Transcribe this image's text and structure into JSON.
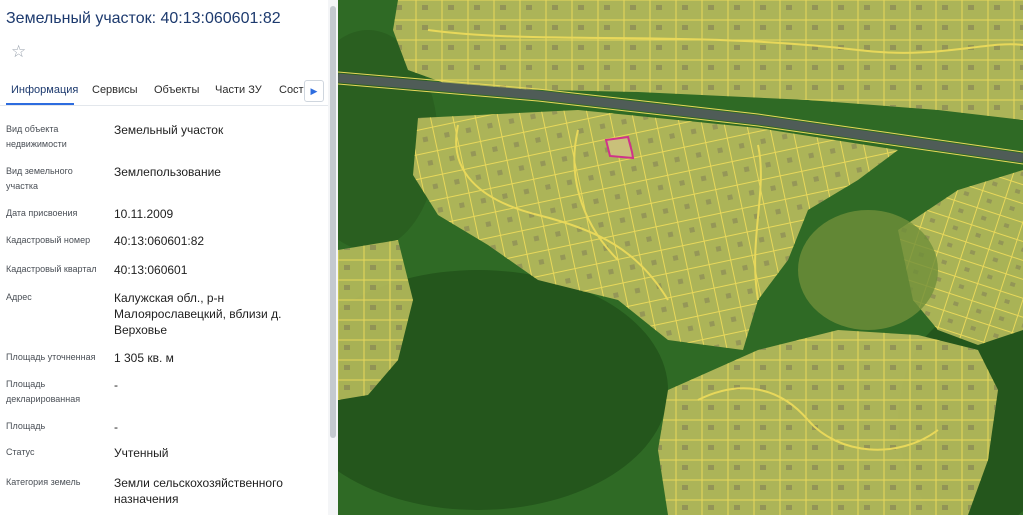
{
  "panel": {
    "title": "Земельный участок: 40:13:060601:82",
    "tabs": [
      {
        "label": "Информация"
      },
      {
        "label": "Сервисы"
      },
      {
        "label": "Объекты"
      },
      {
        "label": "Части ЗУ"
      },
      {
        "label": "Соста"
      }
    ],
    "fields": [
      {
        "label": [
          "Вид объекта",
          "недвижимости"
        ],
        "value": [
          "Земельный участок"
        ]
      },
      {
        "label": [
          "Вид земельного",
          "участка"
        ],
        "value": [
          "Землепользование"
        ]
      },
      {
        "label": [
          "Дата присвоения"
        ],
        "value": [
          "10.11.2009"
        ]
      },
      {
        "label": [
          "Кадастровый номер"
        ],
        "value": [
          "40:13:060601:82"
        ]
      },
      {
        "label": [
          "Кадастровый квартал"
        ],
        "value": [
          "40:13:060601"
        ]
      },
      {
        "label": [
          "Адрес"
        ],
        "value": [
          "Калужская обл., р-н",
          "Малоярославецкий, вблизи д.",
          "Верховье"
        ]
      },
      {
        "label": [
          "Площадь уточненная"
        ],
        "value": [
          "1 305 кв. м"
        ]
      },
      {
        "label": [
          "Площадь",
          "декларированная"
        ],
        "value": [
          "-"
        ]
      },
      {
        "label": [
          "Площадь"
        ],
        "value": [
          "-"
        ]
      },
      {
        "label": [
          "Статус"
        ],
        "value": [
          "Учтенный"
        ]
      },
      {
        "label": [
          "Категория земель"
        ],
        "value": [
          "Земли сельскохозяйственного",
          "назначения"
        ]
      }
    ]
  },
  "icons": {
    "favorite": "star-outline-icon",
    "tabs_scroll": "chevron-right-icon"
  },
  "colors": {
    "title": "#1d3a6e",
    "tab_active_underline": "#2d6cdf",
    "map_forest": "#2f6a25",
    "map_settlement_fill": "#b7bb5c",
    "parcel_outline": "#e8d85a",
    "selected_parcel_outline": "#d0338a"
  }
}
